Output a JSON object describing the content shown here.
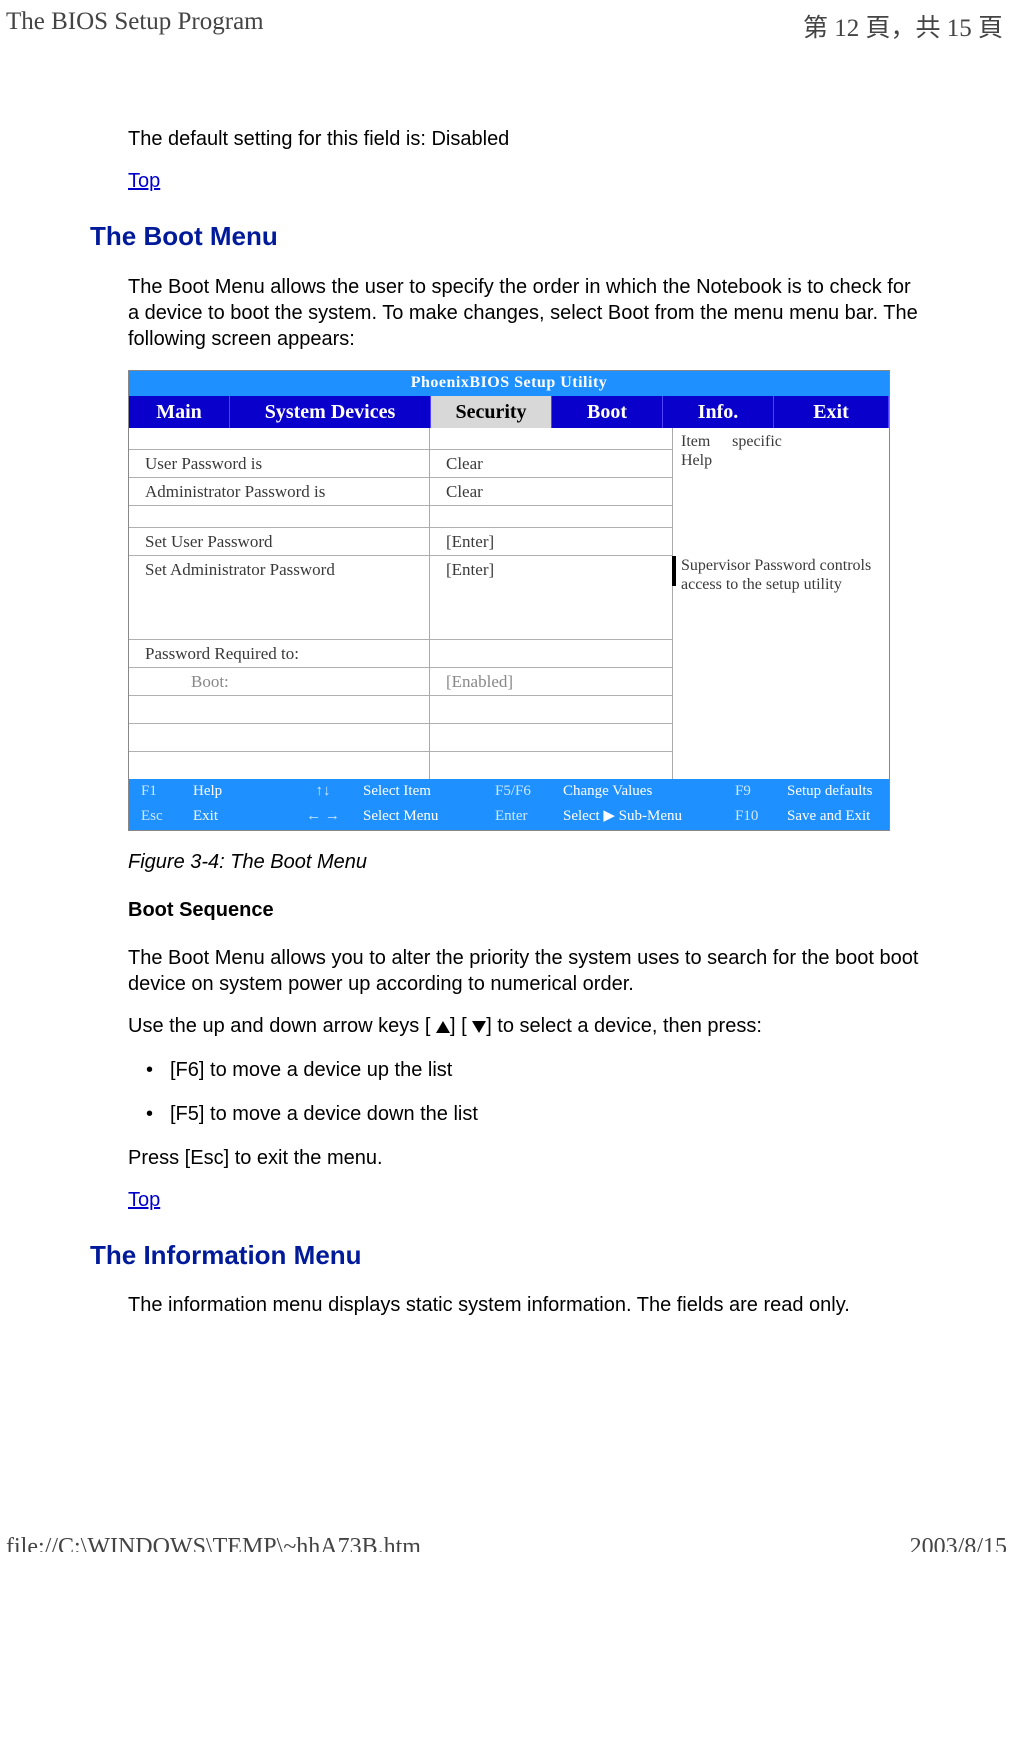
{
  "header": {
    "title_left": "The BIOS Setup Program",
    "title_right": "第 12 頁，共 15 頁"
  },
  "footer": {
    "path": "file://C:\\WINDOWS\\TEMP\\~hhA73B.htm",
    "date": "2003/8/15"
  },
  "intro": {
    "default_text": "The default setting for this field is: Disabled",
    "top_link": "Top"
  },
  "boot_section": {
    "heading": "The Boot Menu",
    "desc": "The Boot Menu allows the user to specify the order in which the Notebook is to check for a device to boot the system. To make changes, select Boot from the menu menu bar. The following screen appears:",
    "caption": "Figure 3-4: The Boot Menu",
    "sub_heading": "Boot Sequence",
    "seq_desc": "The Boot Menu allows you to alter the priority the system uses to search for the boot boot device on system power up according to numerical order.",
    "arrow_before": "Use the up and down arrow keys [ ",
    "arrow_mid": "] [ ",
    "arrow_after": "] to select a device, then press:",
    "bullets": [
      "[F6] to move a device up the list",
      "[F5] to move a device down the list"
    ],
    "esc_text": "Press [Esc] to exit the menu.",
    "top_link": "Top"
  },
  "info_section": {
    "heading": "The Information Menu",
    "desc": "The information menu displays static system information. The fields are read only."
  },
  "bios": {
    "title": "PhoenixBIOS Setup Utility",
    "menu": {
      "main": "Main",
      "system": "System Devices",
      "security": "Security",
      "boot": "Boot",
      "info": "Info.",
      "exit": "Exit"
    },
    "right_help": {
      "l1": "Item",
      "l2": "Help",
      "l3": "specific"
    },
    "rows": {
      "user_pw": "User Password is",
      "user_pw_val": "Clear",
      "admin_pw": "Administrator Password is",
      "admin_pw_val": "Clear",
      "set_user": "Set User Password",
      "set_user_val": "[Enter]",
      "set_admin": "Set Administrator Password",
      "set_admin_val": "[Enter]",
      "help_text": "Supervisor Password controls access to the setup utility",
      "req": "Password Required to:",
      "boot_lbl": "Boot:",
      "boot_val": "[Enabled]"
    },
    "footer": {
      "r1": {
        "k1": "F1",
        "l1": "Help",
        "arr": "↑↓",
        "l2": "Select Item",
        "k2": "F5/F6",
        "l3": "Change Values",
        "k3": "F9",
        "l4": "Setup defaults"
      },
      "r2": {
        "k1": "Esc",
        "l1": "Exit",
        "arr": "← →",
        "l2": "Select Menu",
        "k2": "Enter",
        "l3": "Select ▶ Sub-Menu",
        "k3": "F10",
        "l4": "Save and Exit"
      }
    }
  }
}
